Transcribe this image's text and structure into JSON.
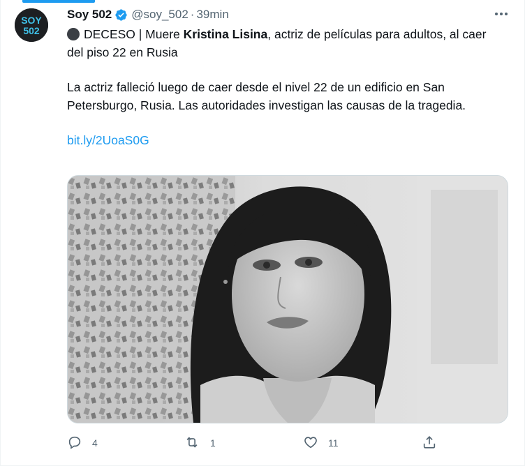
{
  "tweet": {
    "display_name": "Soy 502",
    "handle": "@soy_502",
    "separator": "·",
    "time": "39min",
    "avatar_text_top": "SOY",
    "avatar_text_bottom": "502",
    "line1_prefix": "DECESO | Muere ",
    "line1_bold": "Kristina Lisina",
    "line1_suffix": ", actriz de películas para adultos, al caer del piso 22 en Rusia",
    "paragraph2": "La actriz falleció luego de caer desde el nivel 22 de un edificio en San Petersburgo, Rusia. Las autoridades investigan las causas de la tragedia.",
    "link": "bit.ly/2UoaS0G"
  },
  "actions": {
    "replies": "4",
    "retweets": "1",
    "likes": "11"
  },
  "icons": {
    "verified": "verified-badge-icon",
    "more": "more-dots-icon",
    "reply": "reply-icon",
    "retweet": "retweet-icon",
    "like": "heart-icon",
    "share": "share-icon"
  },
  "colors": {
    "accent": "#1d9bf0",
    "text": "#0f1419",
    "secondary": "#536471",
    "avatar_bg": "#1d1f22"
  }
}
